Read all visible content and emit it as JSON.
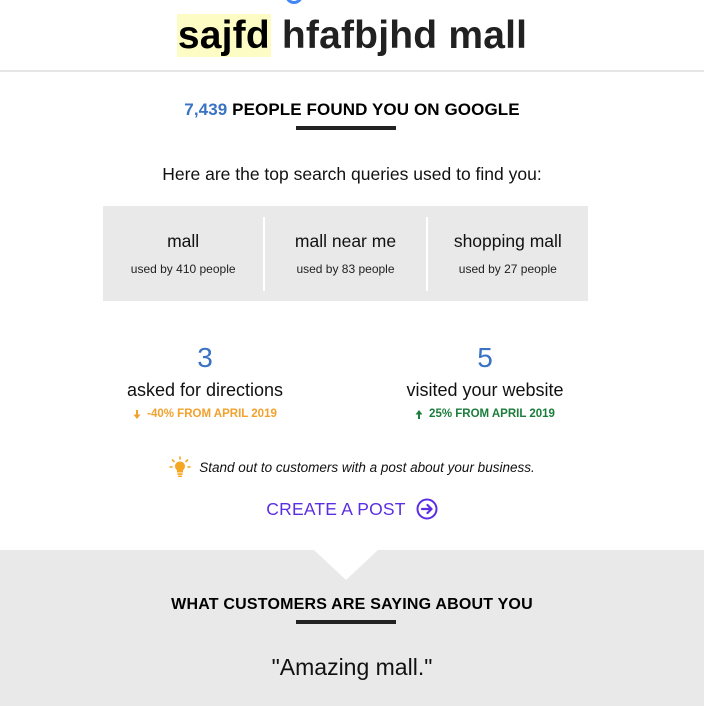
{
  "business": {
    "name_highlight": "sajfd",
    "name_rest": " hfafbjhd mall"
  },
  "found": {
    "count": "7,439",
    "text": "PEOPLE FOUND YOU ON GOOGLE"
  },
  "queries_intro": "Here are the top search queries used to find you:",
  "queries": [
    {
      "label": "mall",
      "usage": "used by 410 people"
    },
    {
      "label": "mall near me",
      "usage": "used by 83 people"
    },
    {
      "label": "shopping mall",
      "usage": "used by 27 people"
    }
  ],
  "stats": {
    "directions": {
      "value": "3",
      "label": "asked for directions",
      "change": "-40% FROM APRIL 2019",
      "direction": "down",
      "color": "#f2a12d"
    },
    "website": {
      "value": "5",
      "label": "visited your website",
      "change": "25% FROM APRIL 2019",
      "direction": "up",
      "color": "#1b7d3c"
    }
  },
  "tip": {
    "icon": "lightbulb-icon",
    "text": "Stand out to customers with a post about your business."
  },
  "cta": {
    "label": "CREATE A POST",
    "icon": "arrow-right-circle-icon"
  },
  "reviews": {
    "title": "WHAT CUSTOMERS ARE SAYING ABOUT YOU",
    "quote": "\"Amazing mall.\""
  },
  "colors": {
    "accent_blue": "#3a72c4",
    "cta_purple": "#5b2ee3",
    "panel_gray": "#e9e9e9",
    "highlight_yellow": "#fcfcc4"
  }
}
